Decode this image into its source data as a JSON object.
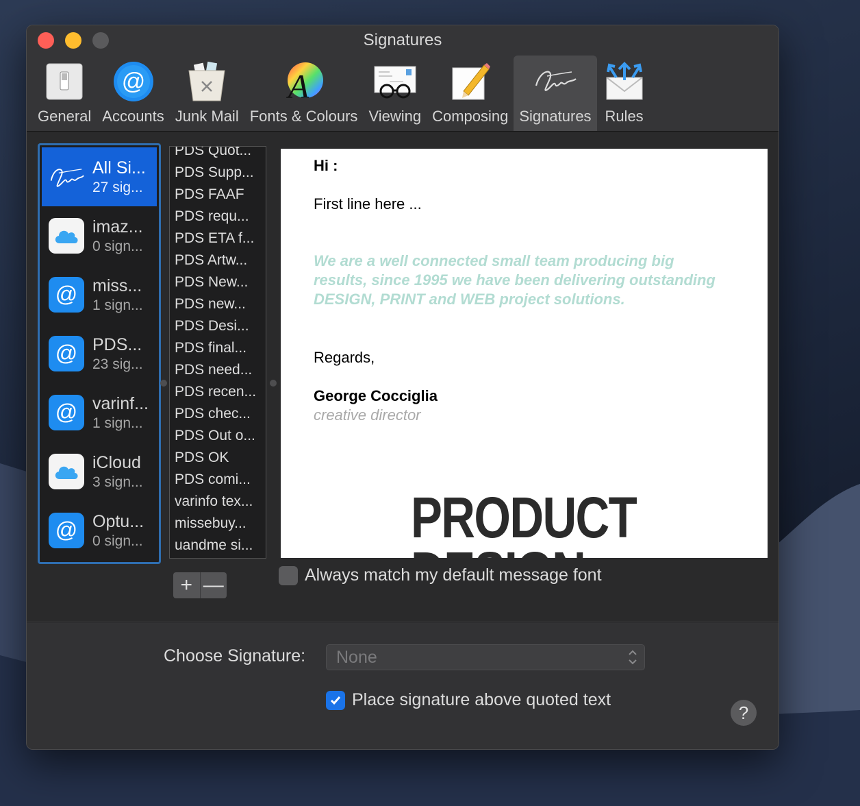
{
  "window": {
    "title": "Signatures"
  },
  "toolbar": [
    {
      "label": "General",
      "icon": "general-switch-icon"
    },
    {
      "label": "Accounts",
      "icon": "accounts-at-icon"
    },
    {
      "label": "Junk Mail",
      "icon": "junk-mail-bin-icon"
    },
    {
      "label": "Fonts & Colours",
      "icon": "fonts-colours-icon"
    },
    {
      "label": "Viewing",
      "icon": "viewing-glasses-icon"
    },
    {
      "label": "Composing",
      "icon": "composing-pencil-icon"
    },
    {
      "label": "Signatures",
      "icon": "signature-icon",
      "active": true
    },
    {
      "label": "Rules",
      "icon": "rules-envelope-icon"
    }
  ],
  "accounts": [
    {
      "name": "All Si...",
      "sub": "27 sig...",
      "type": "signature",
      "selected": true
    },
    {
      "name": "imaz...",
      "sub": "0 sign...",
      "type": "icloud"
    },
    {
      "name": "miss...",
      "sub": "1 sign...",
      "type": "at"
    },
    {
      "name": "PDS...",
      "sub": "23 sig...",
      "type": "at"
    },
    {
      "name": "varinf...",
      "sub": "1 sign...",
      "type": "at"
    },
    {
      "name": "iCloud",
      "sub": "3 sign...",
      "type": "icloud"
    },
    {
      "name": "Optu...",
      "sub": "0 sign...",
      "type": "at"
    }
  ],
  "signatures": [
    "PDS Quot...",
    "PDS Supp...",
    "PDS FAAF",
    "PDS requ...",
    "PDS ETA f...",
    "PDS Artw...",
    "PDS New...",
    "PDS new...",
    "PDS Desi...",
    "PDS final...",
    "PDS need...",
    "PDS recen...",
    "PDS chec...",
    "PDS Out o...",
    "PDS OK",
    "PDS comi...",
    "varinfo tex...",
    "missebuy...",
    "uandme si..."
  ],
  "buttons": {
    "add": "+",
    "remove": "—",
    "help": "?"
  },
  "preview": {
    "greeting": "Hi :",
    "first_line": "First line here ...",
    "tagline": "We are a well connected small team producing big results, since 1995 we have been delivering outstanding DESIGN, PRINT and WEB project solutions.",
    "regards": "Regards,",
    "name": "George Cocciglia",
    "role": "creative director",
    "logo_line1": "PRODUCT",
    "logo_line2": "DESIGN"
  },
  "options": {
    "match_font_label": "Always match my default message font",
    "match_font_checked": false,
    "choose_label": "Choose Signature:",
    "choose_value": "None",
    "above_quoted_label": "Place signature above quoted text",
    "above_quoted_checked": true
  },
  "colors": {
    "accent": "#1462d9",
    "tagline": "#b2dcd2",
    "window_bg": "#2a2a2b"
  }
}
